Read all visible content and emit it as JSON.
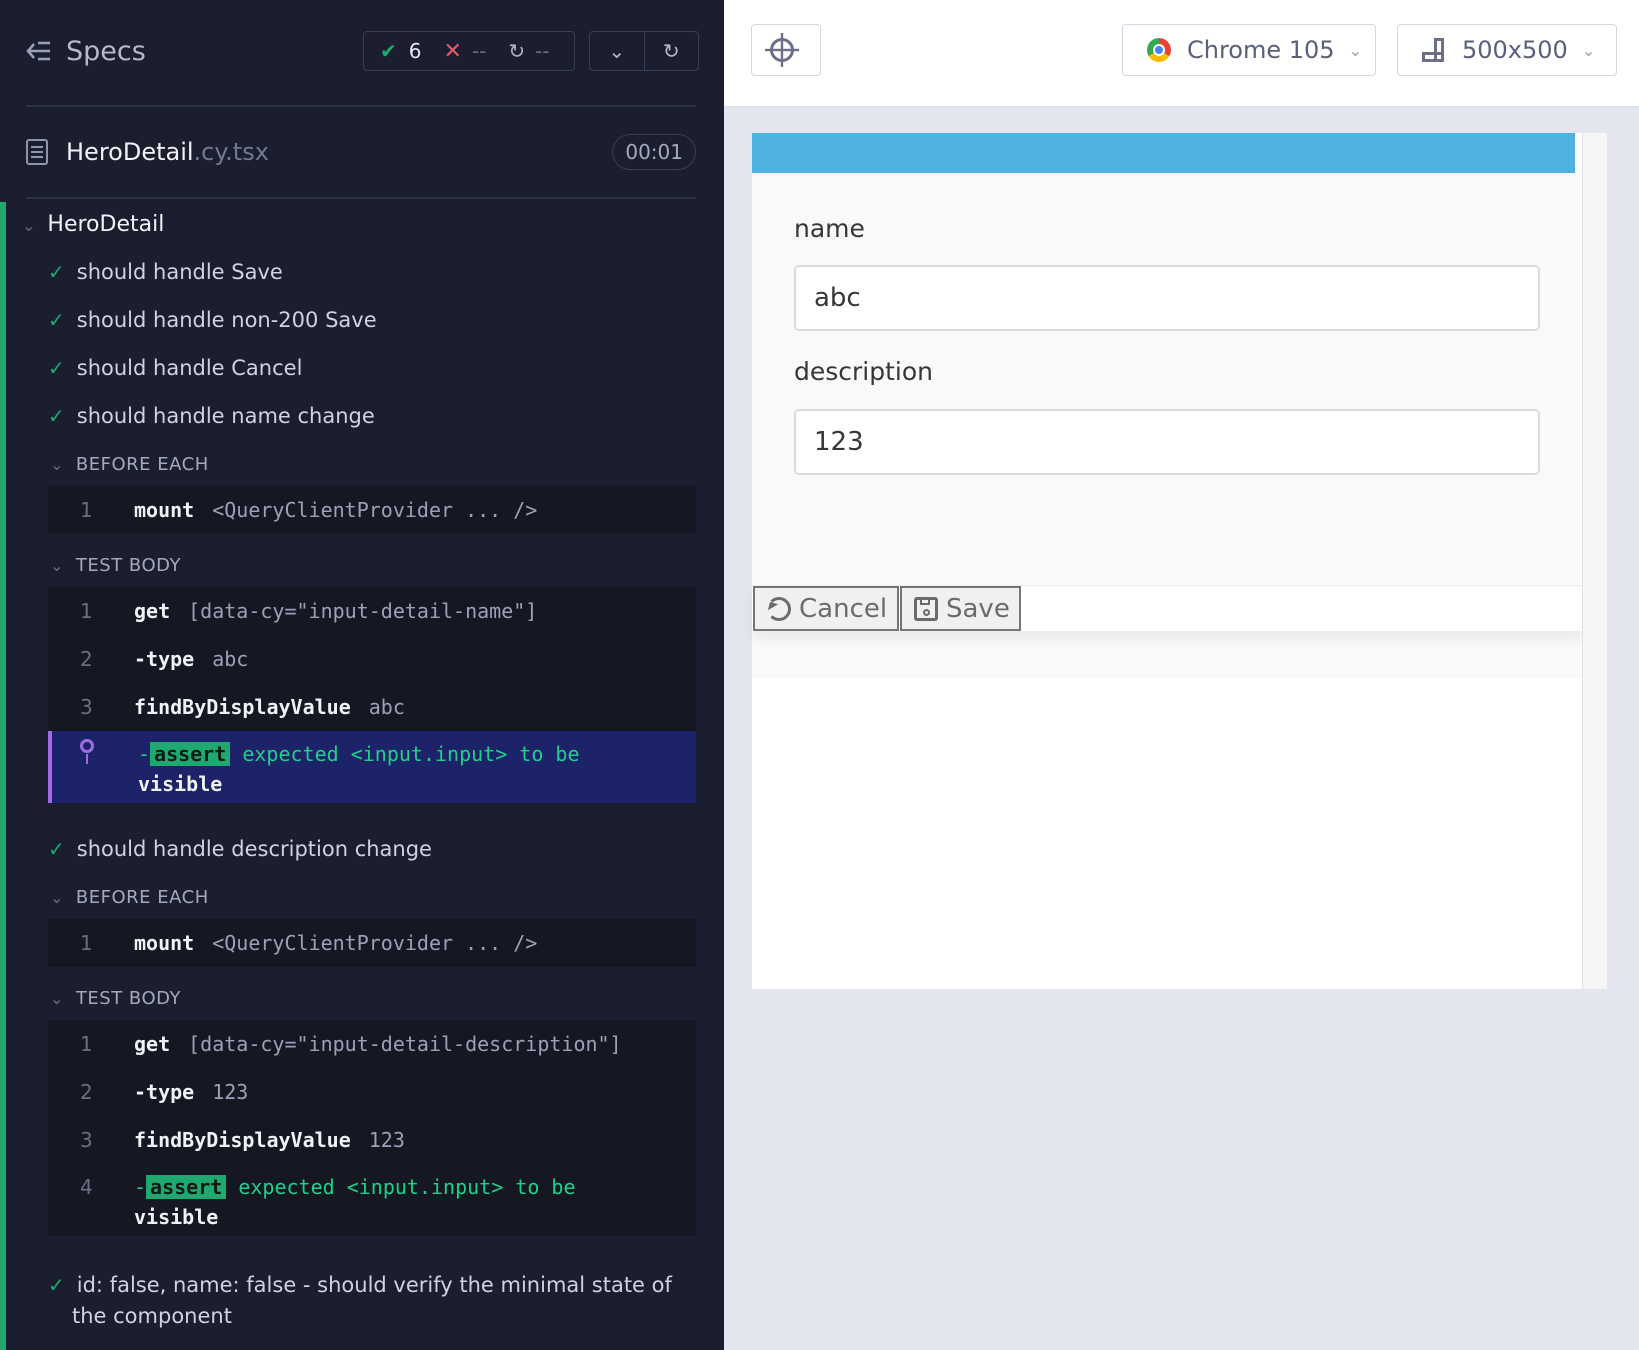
{
  "reporter": {
    "specs_label": "Specs",
    "stats": {
      "passed": "6",
      "failed": "--",
      "pending": "--"
    },
    "file": {
      "name": "HeroDetail",
      "ext": ".cy.tsx",
      "duration": "00:01"
    },
    "suite": "HeroDetail",
    "tests": [
      "should handle Save",
      "should handle non-200 Save",
      "should handle Cancel",
      "should handle name change",
      "should handle description change",
      "id: false, name: false - should verify the minimal state of the component"
    ],
    "hooks": {
      "before_each": "BEFORE EACH",
      "test_body": "TEST BODY"
    },
    "name_change": {
      "before_each": [
        {
          "num": "1",
          "cmd": "mount",
          "arg": "<QueryClientProvider ... />"
        }
      ],
      "test_body": [
        {
          "num": "1",
          "cmd": "get",
          "arg": "[data-cy=\"input-detail-name\"]"
        },
        {
          "num": "2",
          "cmd": "-type",
          "arg": "abc"
        },
        {
          "num": "3",
          "cmd": "findByDisplayValue",
          "arg": "abc"
        }
      ],
      "assert": {
        "dash": "-",
        "badge": "assert",
        "text": "expected",
        "el": "<input.input>",
        "tobe": "to be",
        "val": "visible"
      }
    },
    "desc_change": {
      "before_each": [
        {
          "num": "1",
          "cmd": "mount",
          "arg": "<QueryClientProvider ... />"
        }
      ],
      "test_body": [
        {
          "num": "1",
          "cmd": "get",
          "arg": "[data-cy=\"input-detail-description\"]"
        },
        {
          "num": "2",
          "cmd": "-type",
          "arg": "123"
        },
        {
          "num": "3",
          "cmd": "findByDisplayValue",
          "arg": "123"
        }
      ],
      "assert": {
        "num": "4",
        "dash": "-",
        "badge": "assert",
        "text": "expected",
        "el": "<input.input>",
        "tobe": "to be",
        "val": "visible"
      }
    }
  },
  "topbar": {
    "browser": "Chrome 105",
    "viewport": "500x500"
  },
  "aut": {
    "name_label": "name",
    "name_value": "abc",
    "description_label": "description",
    "description_value": "123",
    "cancel_label": "Cancel",
    "save_label": "Save"
  },
  "colors": {
    "pass": "#1fa971",
    "fail": "#e45770",
    "accent": "#a06ce4",
    "band": "#4fb1e1"
  }
}
